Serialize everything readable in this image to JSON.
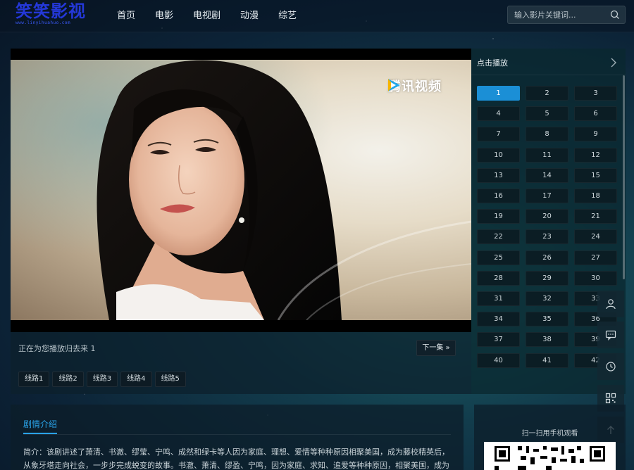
{
  "header": {
    "logo_text": "笑笑影视",
    "logo_sub": "www.linyihuahuo.com",
    "nav": [
      "首页",
      "电影",
      "电视剧",
      "动漫",
      "综艺"
    ],
    "search_placeholder": "输入影片关键词..."
  },
  "player": {
    "watermark": "腾讯视频",
    "now_playing": "正在为您播放归去来 1",
    "next_label": "下一集",
    "lines": [
      "线路1",
      "线路2",
      "线路3",
      "线路4",
      "线路5"
    ]
  },
  "episodes": {
    "title": "点击播放",
    "active": "1",
    "items": [
      "1",
      "2",
      "3",
      "4",
      "5",
      "6",
      "7",
      "8",
      "9",
      "10",
      "11",
      "12",
      "13",
      "14",
      "15",
      "16",
      "17",
      "18",
      "19",
      "20",
      "21",
      "22",
      "23",
      "24",
      "25",
      "26",
      "27",
      "28",
      "29",
      "30",
      "31",
      "32",
      "33",
      "34",
      "35",
      "36",
      "37",
      "38",
      "39",
      "40",
      "41",
      "42"
    ]
  },
  "synopsis": {
    "title": "剧情介绍",
    "text": "简介：该剧讲述了萧清、书澈、缪莹、宁鸣、成然和绿卡等人因为家庭、理想、爱情等种种原因相聚美国，成为藤校精英后，从象牙塔走向社会，一步步完成蜕变的故事。书澈、萧清、缪盈、宁鸣，因为家庭、求知、追爱等种种原因，相聚美国，成为了海外留学"
  },
  "qr": {
    "text": "扫一扫用手机观看"
  },
  "tools": [
    "user-icon",
    "message-icon",
    "history-icon",
    "qrcode-icon",
    "back-to-top-icon"
  ],
  "colors": {
    "accent": "#2aa3e8",
    "active_episode": "#1b8fd6",
    "logo": "#2438d8"
  }
}
